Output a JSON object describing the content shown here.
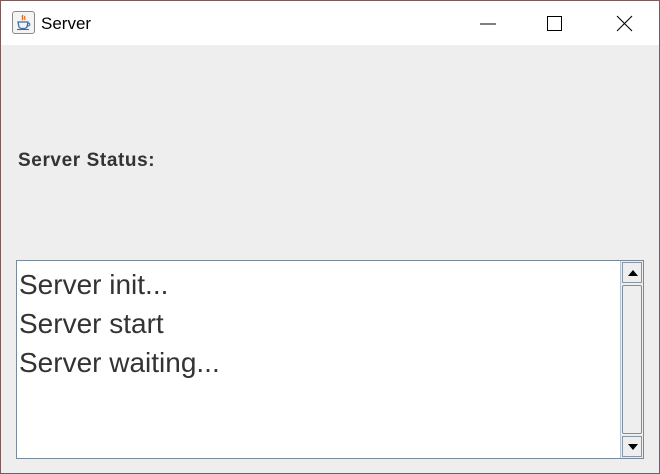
{
  "window": {
    "title": "Server",
    "icon": "java-cup-icon",
    "controls": {
      "minimize": "minimize-icon",
      "maximize": "maximize-icon",
      "close": "close-icon"
    }
  },
  "main": {
    "status_label": "Server Status:",
    "log_lines": [
      "Server init...",
      "Server start",
      "Server waiting..."
    ]
  },
  "colors": {
    "title_bar": "#ffffff",
    "window_bg": "#eeeeee",
    "text": "#333333",
    "log_bg": "#ffffff",
    "border": "#7a8a9a"
  }
}
